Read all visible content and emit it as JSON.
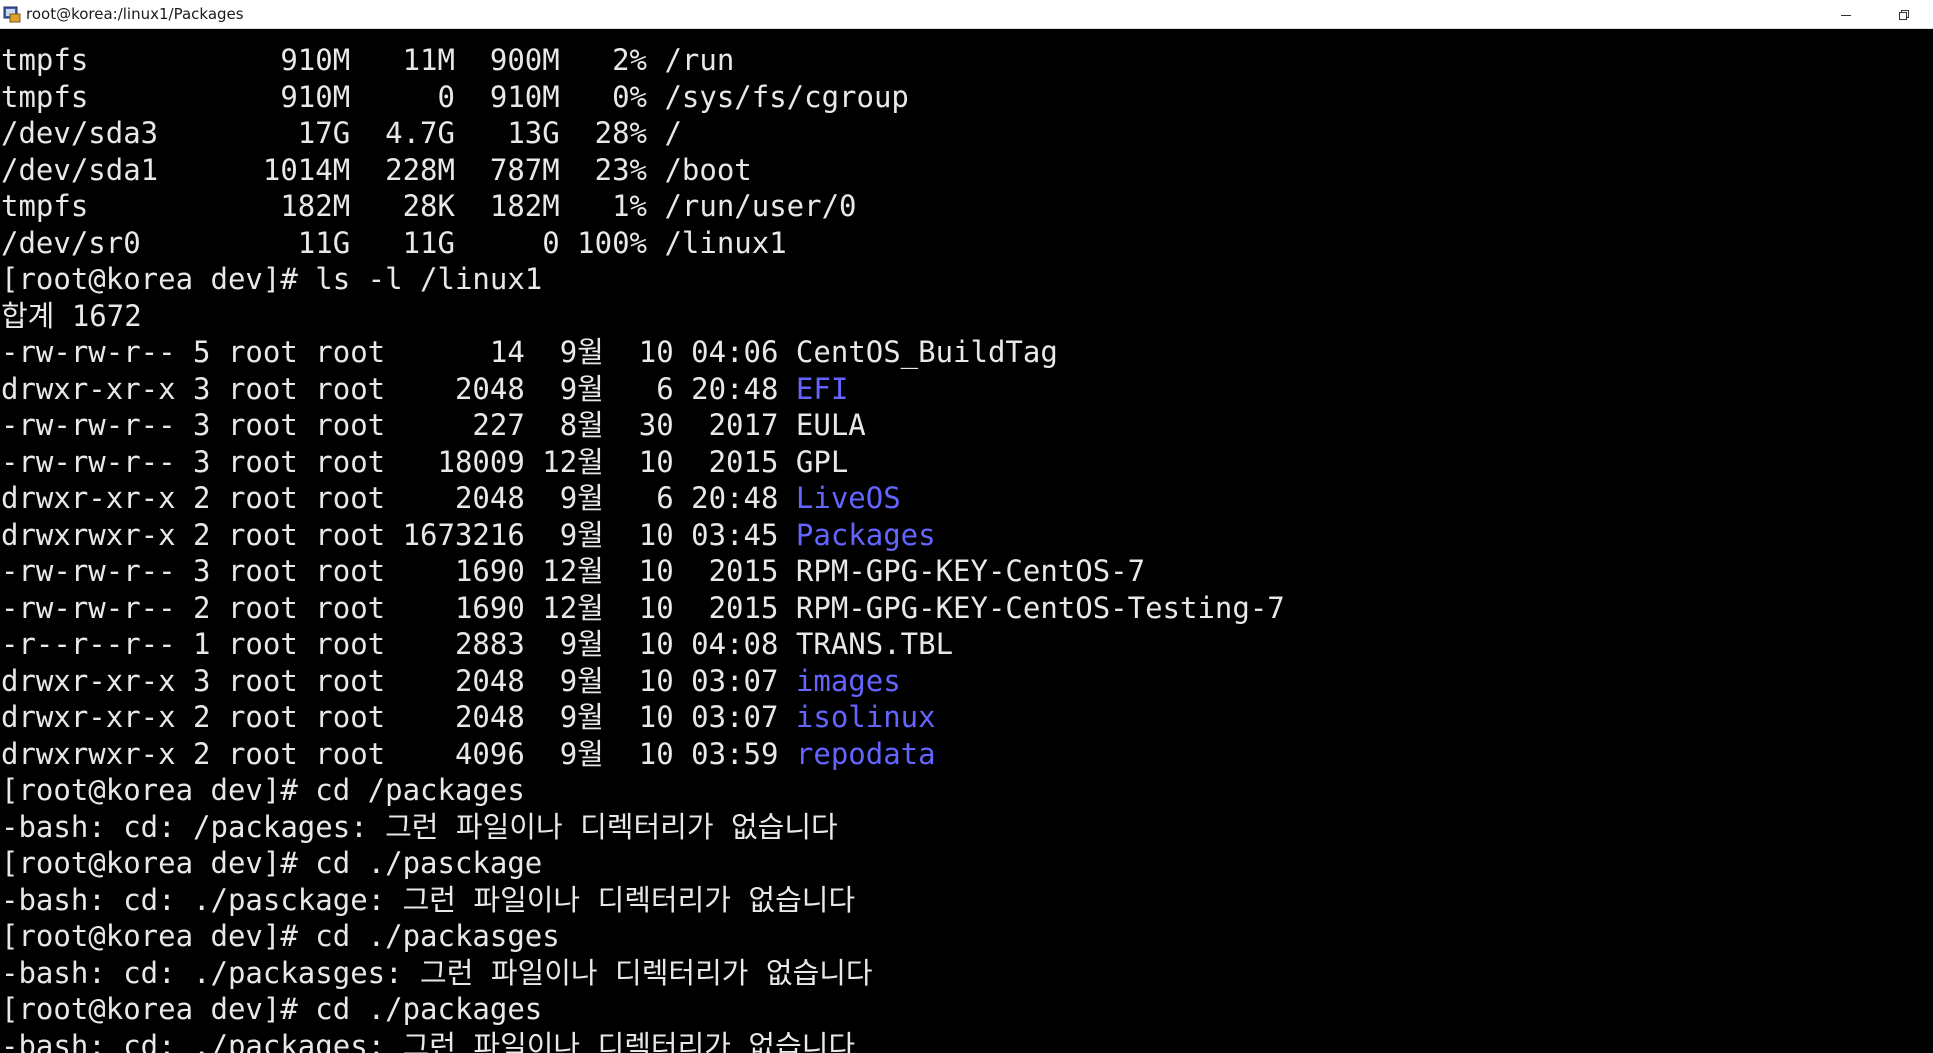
{
  "window": {
    "title": "root@korea:/linux1/Packages"
  },
  "colors": {
    "background": "#000000",
    "foreground": "#e8e8e8",
    "directory": "#6464ff"
  },
  "terminal": {
    "df_rows": [
      "tmpfs           910M   11M  900M   2% /run",
      "tmpfs           910M     0  910M   0% /sys/fs/cgroup",
      "/dev/sda3        17G  4.7G   13G  28% /",
      "/dev/sda1      1014M  228M  787M  23% /boot",
      "tmpfs           182M   28K  182M   1% /run/user/0",
      "/dev/sr0         11G   11G     0 100% /linux1"
    ],
    "ls_command": "[root@korea dev]# ls -l /linux1",
    "total": "합계 1672",
    "ls_rows": [
      {
        "meta": "-rw-rw-r-- 5 root root      14  9월  10 04:06 ",
        "name": "CentOS_BuildTag",
        "is_dir": false
      },
      {
        "meta": "drwxr-xr-x 3 root root    2048  9월   6 20:48 ",
        "name": "EFI",
        "is_dir": true
      },
      {
        "meta": "-rw-rw-r-- 3 root root     227  8월  30  2017 ",
        "name": "EULA",
        "is_dir": false
      },
      {
        "meta": "-rw-rw-r-- 3 root root   18009 12월  10  2015 ",
        "name": "GPL",
        "is_dir": false
      },
      {
        "meta": "drwxr-xr-x 2 root root    2048  9월   6 20:48 ",
        "name": "LiveOS",
        "is_dir": true
      },
      {
        "meta": "drwxrwxr-x 2 root root 1673216  9월  10 03:45 ",
        "name": "Packages",
        "is_dir": true
      },
      {
        "meta": "-rw-rw-r-- 3 root root    1690 12월  10  2015 ",
        "name": "RPM-GPG-KEY-CentOS-7",
        "is_dir": false
      },
      {
        "meta": "-rw-rw-r-- 2 root root    1690 12월  10  2015 ",
        "name": "RPM-GPG-KEY-CentOS-Testing-7",
        "is_dir": false
      },
      {
        "meta": "-r--r--r-- 1 root root    2883  9월  10 04:08 ",
        "name": "TRANS.TBL",
        "is_dir": false
      },
      {
        "meta": "drwxr-xr-x 3 root root    2048  9월  10 03:07 ",
        "name": "images",
        "is_dir": true
      },
      {
        "meta": "drwxr-xr-x 2 root root    2048  9월  10 03:07 ",
        "name": "isolinux",
        "is_dir": true
      },
      {
        "meta": "drwxrwxr-x 2 root root    4096  9월  10 03:59 ",
        "name": "repodata",
        "is_dir": true
      }
    ],
    "tail_lines": [
      "[root@korea dev]# cd /packages",
      "-bash: cd: /packages: 그런 파일이나 디렉터리가 없습니다",
      "[root@korea dev]# cd ./pasckage",
      "-bash: cd: ./pasckage: 그런 파일이나 디렉터리가 없습니다",
      "[root@korea dev]# cd ./packasges",
      "-bash: cd: ./packasges: 그런 파일이나 디렉터리가 없습니다",
      "[root@korea dev]# cd ./packages",
      "-bash: cd: ./packages: 그런 파일이나 디렉터리가 없습니다"
    ]
  }
}
